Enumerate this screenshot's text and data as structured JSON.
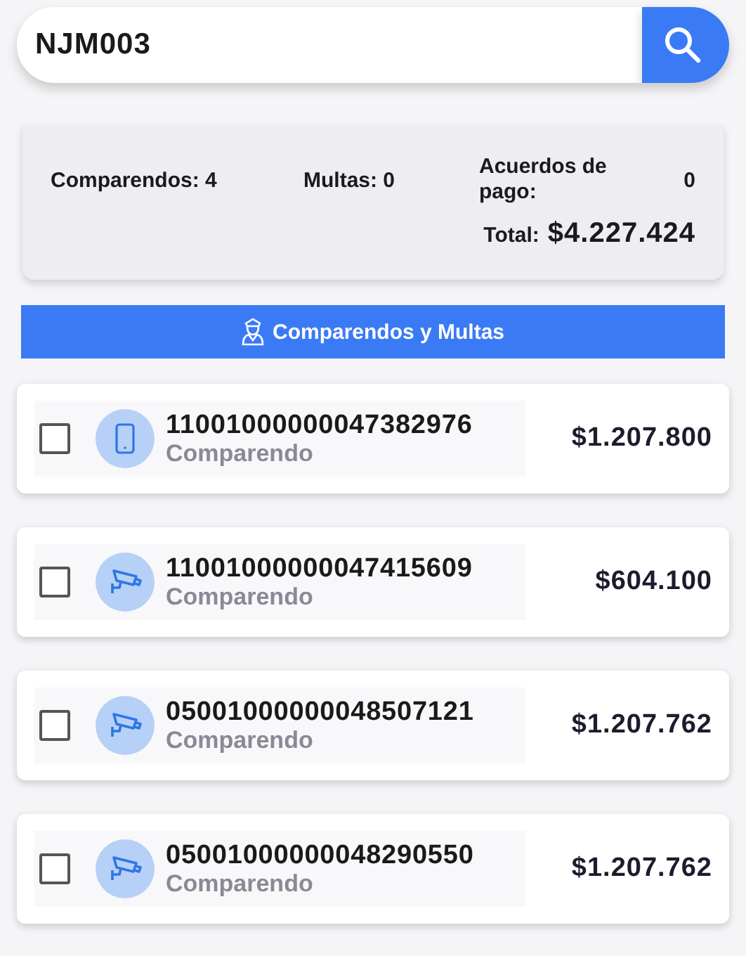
{
  "search": {
    "value": "NJM003"
  },
  "summary": {
    "comparendos_label": "Comparendos:",
    "comparendos": "4",
    "multas_label": "Multas:",
    "multas": "0",
    "acuerdos_label": "Acuerdos de pago:",
    "acuerdos": "0",
    "total_label": "Total:",
    "total": "$4.227.424"
  },
  "section_button": {
    "label": "Comparendos y Multas"
  },
  "items": [
    {
      "kind": "phone",
      "number": "11001000000047382976",
      "type": "Comparendo",
      "amount": "$1.207.800",
      "checked": false
    },
    {
      "kind": "camera",
      "number": "11001000000047415609",
      "type": "Comparendo",
      "amount": "$604.100",
      "checked": false
    },
    {
      "kind": "camera",
      "number": "05001000000048507121",
      "type": "Comparendo",
      "amount": "$1.207.762",
      "checked": false
    },
    {
      "kind": "camera",
      "number": "05001000000048290550",
      "type": "Comparendo",
      "amount": "$1.207.762",
      "checked": false
    }
  ]
}
